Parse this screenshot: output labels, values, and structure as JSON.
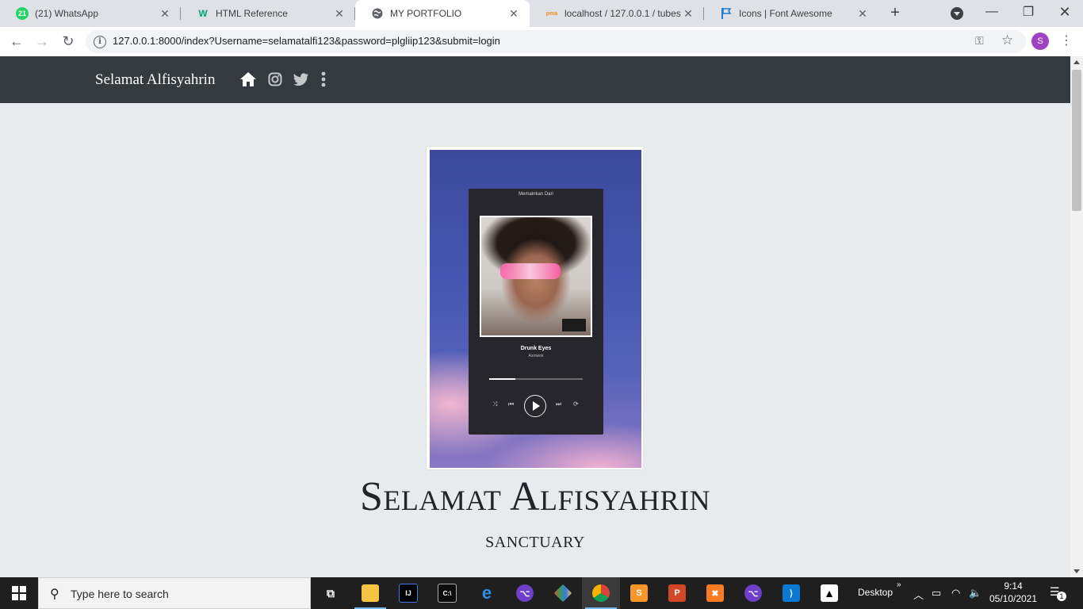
{
  "browser": {
    "tabs": [
      {
        "title": "(21) WhatsApp",
        "favicon_badge": "21",
        "favicon_color": "#25d366",
        "icon": "whatsapp-icon"
      },
      {
        "title": "HTML Reference",
        "favicon_badge": "W",
        "favicon_color": "#04aa6d",
        "icon": "w3schools-icon"
      },
      {
        "title": "MY PORTFOLIO",
        "favicon_badge": "",
        "favicon_color": "#5f6368",
        "icon": "globe-icon",
        "active": true
      },
      {
        "title": "localhost / 127.0.0.1 / tubes /",
        "favicon_badge": "pma",
        "favicon_color": "#f29111",
        "icon": "phpmyadmin-icon"
      },
      {
        "title": "Icons | Font Awesome",
        "favicon_badge": "",
        "favicon_color": "#1c7ed6",
        "icon": "font-awesome-flag-icon"
      }
    ],
    "new_tab": "+",
    "url": "127.0.0.1:8000/index?Username=selamatalfi123&password=plgliip123&submit=login",
    "profile_initial": "S",
    "profile_color": "#a142c4"
  },
  "page": {
    "navbar": {
      "brand": "Selamat Alfisyahrin",
      "icons": [
        "home-icon",
        "instagram-icon",
        "twitter-icon",
        "more-vertical-icon"
      ],
      "bg_color": "#343a40"
    },
    "photo": {
      "header": "Memainkan Dari",
      "song": "Drunk Eyes",
      "artist": "Asmwok",
      "progress": 0.28
    },
    "hero_name": "Selamat Alfisyahrin",
    "hero_subtitle": "SANCTUARY",
    "bg_color": "#e8ebee"
  },
  "taskbar": {
    "search_placeholder": "Type here to search",
    "desktop_label": "Desktop",
    "overflow": "»",
    "time": "9:14",
    "date": "05/10/2021",
    "notifications": "1"
  }
}
